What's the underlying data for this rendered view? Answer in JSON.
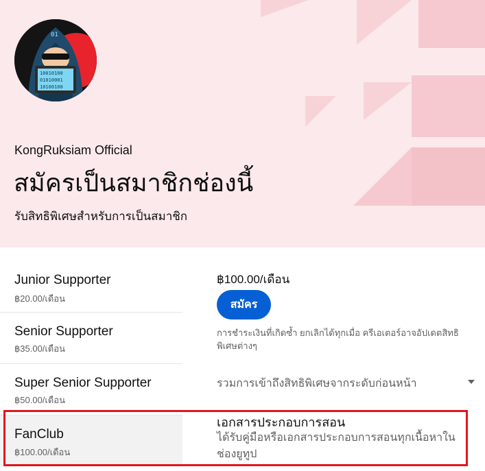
{
  "header": {
    "channel_name": "KongRuksiam Official",
    "title": "สมัครเป็นสมาชิกช่องนี้",
    "subtitle": "รับสิทธิพิเศษสำหรับการเป็นสมาชิก",
    "background_color": "#fbe9eb",
    "accent_color": "#f7d3d8",
    "avatar_text": {
      "badge": "01",
      "line1": "10010100",
      "line2": "01010001",
      "line3": "10100100"
    }
  },
  "tiers": [
    {
      "name": "Junior Supporter",
      "price": "฿20.00/เดือน"
    },
    {
      "name": "Senior Supporter",
      "price": "฿35.00/เดือน"
    },
    {
      "name": "Super Senior Supporter",
      "price": "฿50.00/เดือน"
    },
    {
      "name": "FanClub",
      "price": "฿100.00/เดือน"
    }
  ],
  "detail": {
    "price": "฿100.00/เดือน",
    "join_label": "สมัคร",
    "disclaimer": "การชำระเงินที่เกิดซ้ำ ยกเลิกได้ทุกเมื่อ ครีเอเตอร์อาจอัปเดตสิทธิพิเศษต่างๆ",
    "includes_label": "รวมการเข้าถึงสิทธิพิเศษจากระดับก่อนหน้า",
    "perk_title": "เอกสารประกอบการสอน",
    "perk_desc": "ได้รับคู่มือหรือเอกสารประกอบการสอนทุกเนื้อหาในช่องยูทูป",
    "button_color": "#065fd4",
    "highlight_color": "#e3151c"
  }
}
